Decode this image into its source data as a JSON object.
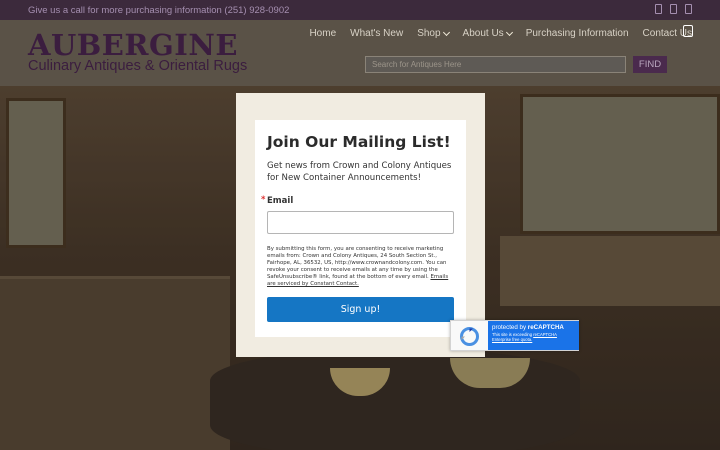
{
  "topbar": {
    "phone_text": "Give us a call for more purchasing information (251) 928-0902",
    "social_icons": [
      "facebook-icon",
      "instagram-icon",
      "pinterest-icon"
    ]
  },
  "brand": {
    "name": "AUBERGINE",
    "tagline": "Culinary Antiques & Oriental Rugs",
    "color": "#3b1d3f"
  },
  "nav": {
    "items": [
      {
        "label": "Home"
      },
      {
        "label": "What's New"
      },
      {
        "label": "Shop"
      },
      {
        "label": "About Us"
      },
      {
        "label": "Purchasing Information"
      },
      {
        "label": "Contact Us"
      }
    ]
  },
  "search": {
    "placeholder": "Search for Antiques Here",
    "button_label": "FIND"
  },
  "modal": {
    "title": "Join Our Mailing List!",
    "subtitle": "Get news from Crown and Colony Antiques for New Container Announcements!",
    "required_mark": "*",
    "email_label": "Email",
    "email_value": "",
    "legal_text": "By submitting this form, you are consenting to receive marketing emails from: Crown and Colony Antiques, 24 South Section St., Fairhope, AL, 36532, US, http://www.crownandcolony.com. You can revoke your consent to receive emails at any time by using the SafeUnsubscribe® link, found at the bottom of every email.",
    "legal_link": "Emails are serviced by Constant Contact.",
    "signup_label": "Sign up!",
    "button_color": "#1576c4"
  },
  "recaptcha": {
    "line1_prefix": "protected by ",
    "line1_brand": "reCAPTCHA",
    "line2_prefix": "This site is exceeding ",
    "line2_link": "reCAPTCHA Enterprise free quota."
  }
}
